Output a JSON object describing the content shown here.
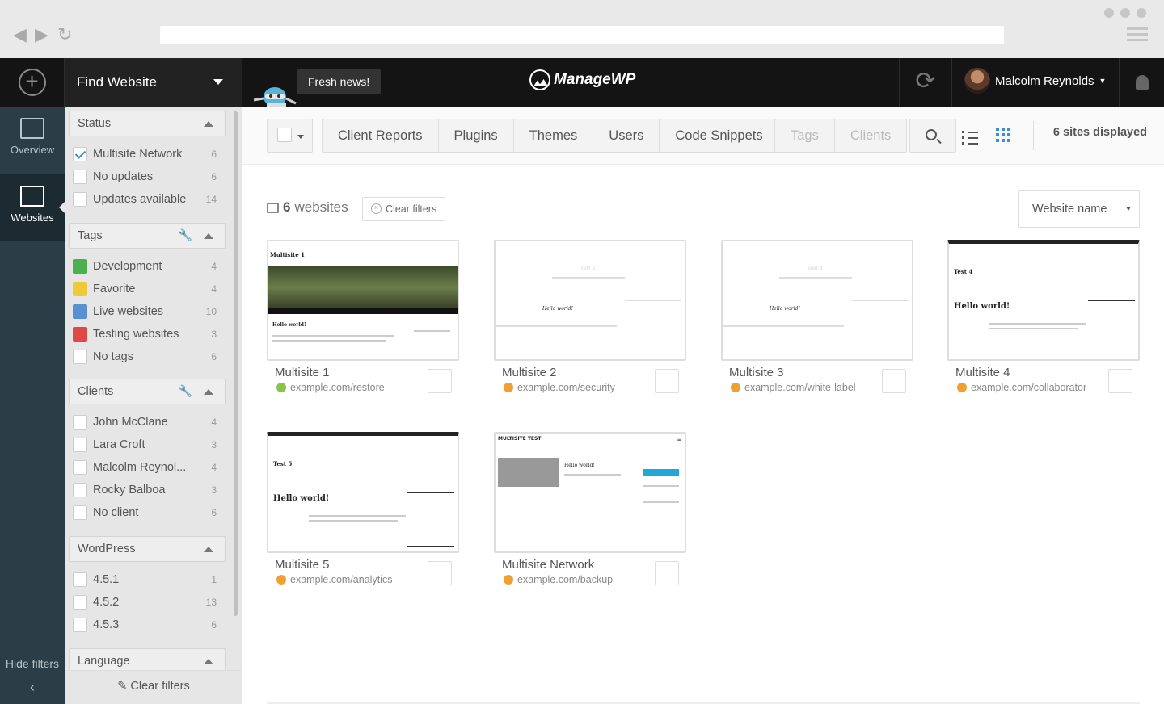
{
  "topbar": {
    "find_website": "Find Website",
    "news": "Fresh news!",
    "logo": "ManageWP",
    "user": "Malcolm Reynolds"
  },
  "nav": {
    "overview": "Overview",
    "websites": "Websites",
    "hide_filters": "Hide filters"
  },
  "filters": {
    "status": {
      "title": "Status",
      "items": [
        {
          "label": "Multisite Network",
          "count": "6",
          "checked": true
        },
        {
          "label": "No updates",
          "count": "6"
        },
        {
          "label": "Updates available",
          "count": "14"
        }
      ]
    },
    "tags": {
      "title": "Tags",
      "items": [
        {
          "label": "Development",
          "count": "4",
          "color": "#4caf50"
        },
        {
          "label": "Favorite",
          "count": "4",
          "color": "#f0c93a"
        },
        {
          "label": "Live websites",
          "count": "10",
          "color": "#5b8fd4"
        },
        {
          "label": "Testing websites",
          "count": "3",
          "color": "#e04848"
        },
        {
          "label": "No tags",
          "count": "6"
        }
      ]
    },
    "clients": {
      "title": "Clients",
      "items": [
        {
          "label": "John McClane",
          "count": "4"
        },
        {
          "label": "Lara Croft",
          "count": "3"
        },
        {
          "label": "Malcolm Reynol...",
          "count": "4"
        },
        {
          "label": "Rocky Balboa",
          "count": "3"
        },
        {
          "label": "No client",
          "count": "6"
        }
      ]
    },
    "wordpress": {
      "title": "WordPress",
      "items": [
        {
          "label": "4.5.1",
          "count": "1"
        },
        {
          "label": "4.5.2",
          "count": "13"
        },
        {
          "label": "4.5.3",
          "count": "6"
        }
      ]
    },
    "language": {
      "title": "Language"
    },
    "clear": "Clear filters"
  },
  "toolbar": {
    "group1": [
      "Client Reports",
      "Plugins",
      "Themes",
      "Users",
      "Code Snippets"
    ],
    "group2": [
      "Tags",
      "Clients"
    ],
    "sites_count": "6",
    "sites_suffix": "sites displayed"
  },
  "content": {
    "count": "6",
    "count_suffix": "websites",
    "clear_filters": "Clear filters",
    "sort": "Website name",
    "sites": [
      {
        "name": "Multisite 1",
        "url": "example.com/restore",
        "globe": "#8bc34a",
        "thumb_title": "Multisite 1",
        "thumb_heading": "Hello world!"
      },
      {
        "name": "Multisite 2",
        "url": "example.com/security",
        "globe": "#f0a030",
        "thumb_title": "Test 2",
        "thumb_heading": "Hello world!"
      },
      {
        "name": "Multisite 3",
        "url": "example.com/white-label",
        "globe": "#f0a030",
        "thumb_title": "Test 3",
        "thumb_heading": "Hello world!"
      },
      {
        "name": "Multisite 4",
        "url": "example.com/collaborator",
        "globe": "#f0a030",
        "thumb_title": "Test 4",
        "thumb_heading": "Hello world!"
      },
      {
        "name": "Multisite 5",
        "url": "example.com/analytics",
        "globe": "#f0a030",
        "thumb_title": "Test 5",
        "thumb_heading": "Hello world!"
      },
      {
        "name": "Multisite Network",
        "url": "example.com/backup",
        "globe": "#f0a030",
        "thumb_title": "MULTISITE TEST",
        "thumb_heading": "Hello world!"
      }
    ]
  }
}
